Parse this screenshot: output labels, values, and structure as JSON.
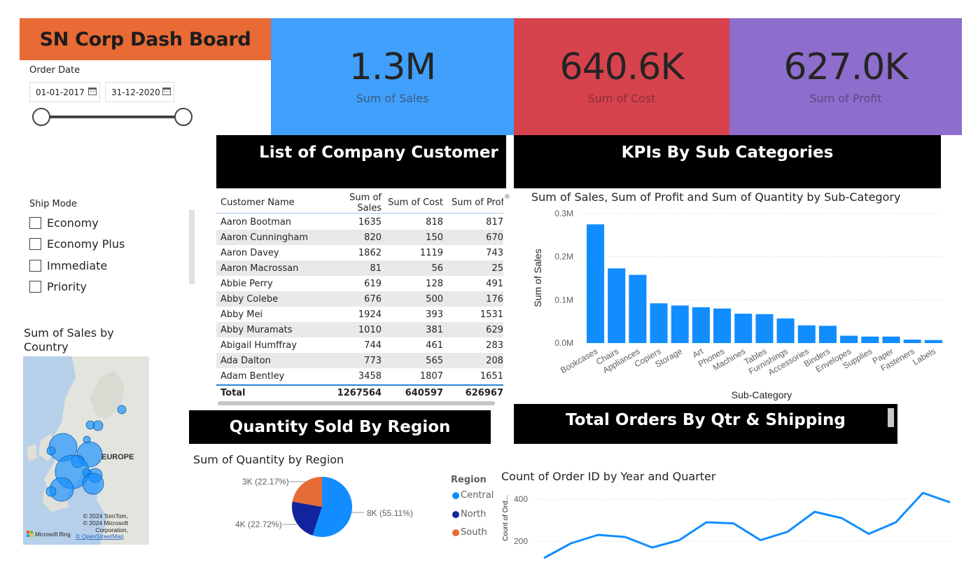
{
  "title": "SN Corp Dash Board",
  "kpis": {
    "sales": {
      "value": "1.3M",
      "label": "Sum of Sales"
    },
    "cost": {
      "value": "640.6K",
      "label": "Sum of Cost"
    },
    "profit": {
      "value": "627.0K",
      "label": "Sum of Profit"
    }
  },
  "headers": {
    "customers": "List of Company Customer",
    "kpis": "KPIs  By Sub Categories",
    "region": "Quantity Sold By Region",
    "orders": "Total Orders By Qtr & Shipping"
  },
  "order_date": {
    "label": "Order Date",
    "start": "01-01-2017",
    "end": "31-12-2020"
  },
  "ship_mode": {
    "label": "Ship Mode",
    "options": [
      "Economy",
      "Economy Plus",
      "Immediate",
      "Priority"
    ]
  },
  "map": {
    "title": "Sum of Sales by Country",
    "region_label": "EUROPE",
    "credits": [
      "© 2024 TomTom,",
      "© 2024 Microsoft",
      "Corporation,"
    ],
    "link": "© OpenStreetMap",
    "brand": "Microsoft Bing"
  },
  "table": {
    "columns": [
      "Customer Name",
      "Sum of Sales",
      "Sum of Cost",
      "Sum of Profit"
    ],
    "rows": [
      [
        "Aaron Bootman",
        "1635",
        "818",
        "817"
      ],
      [
        "Aaron Cunningham",
        "820",
        "150",
        "670"
      ],
      [
        "Aaron Davey",
        "1862",
        "1119",
        "743"
      ],
      [
        "Aaron Macrossan",
        "81",
        "56",
        "25"
      ],
      [
        "Abbie Perry",
        "619",
        "128",
        "491"
      ],
      [
        "Abby Colebe",
        "676",
        "500",
        "176"
      ],
      [
        "Abby Mei",
        "1924",
        "393",
        "1531"
      ],
      [
        "Abby Muramats",
        "1010",
        "381",
        "629"
      ],
      [
        "Abigail Humffray",
        "744",
        "461",
        "283"
      ],
      [
        "Ada Dalton",
        "773",
        "565",
        "208"
      ],
      [
        "Adam Bentley",
        "3458",
        "1807",
        "1651"
      ]
    ],
    "total": [
      "Total",
      "1267564",
      "640597",
      "626967"
    ]
  },
  "chart_data": [
    {
      "type": "bar",
      "title": "Sum of Sales, Sum of Profit and Sum of Quantity by Sub-Category",
      "xlabel": "Sub-Category",
      "ylabel": "Sum of Sales",
      "ylim": [
        0,
        300000
      ],
      "yticks": [
        "0.0M",
        "0.1M",
        "0.2M",
        "0.3M"
      ],
      "color": "#118DFF",
      "categories": [
        "Bookcases",
        "Chairs",
        "Appliances",
        "Copiers",
        "Storage",
        "Art",
        "Phones",
        "Machines",
        "Tables",
        "Furnishings",
        "Accessories",
        "Binders",
        "Envelopes",
        "Supplies",
        "Paper",
        "Fasteners",
        "Labels"
      ],
      "values": [
        275000,
        173000,
        158000,
        92000,
        87000,
        83000,
        80000,
        68000,
        67000,
        57000,
        41000,
        40000,
        17000,
        15000,
        15000,
        8000,
        7000
      ]
    },
    {
      "type": "pie",
      "title": "Sum of Quantity by Region",
      "legend_title": "Region",
      "series": [
        {
          "name": "Central",
          "value": 8000,
          "label": "8K (55.11%)",
          "color": "#118DFF",
          "percent": 55.11
        },
        {
          "name": "North",
          "value": 4000,
          "label": "4K (22.72%)",
          "color": "#12239E",
          "percent": 22.72
        },
        {
          "name": "South",
          "value": 3000,
          "label": "3K (22.17%)",
          "color": "#E66C37",
          "percent": 22.17
        }
      ]
    },
    {
      "type": "line",
      "title": "Count of Order ID by Year and Quarter",
      "ylabel": "Count of Ord...",
      "yticks": [
        "200",
        "400"
      ],
      "color": "#118DFF",
      "values": [
        120,
        190,
        230,
        220,
        170,
        205,
        290,
        285,
        205,
        245,
        340,
        310,
        235,
        290,
        430,
        385
      ]
    }
  ]
}
